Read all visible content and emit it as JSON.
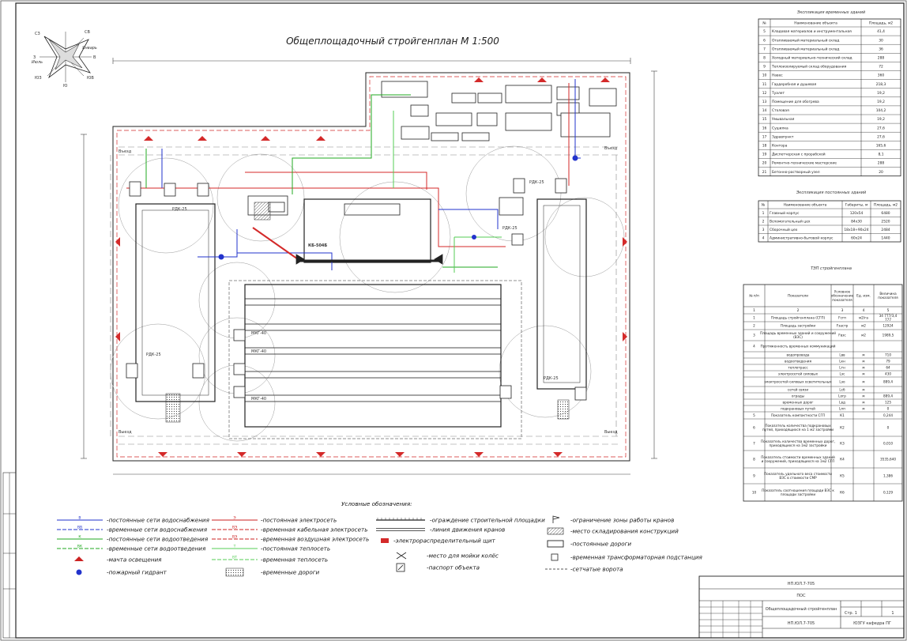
{
  "title": "Общеплощадочный стройгенплан М 1:500",
  "wind_rose": {
    "labels": [
      "СВ",
      "СЗ",
      "Январь",
      "З",
      "В",
      "Июль",
      "ЮЗ",
      "Ю",
      "ЮВ"
    ]
  },
  "plan_labels": {
    "entry_1": "Въезд",
    "entry_2": "Въезд",
    "exit_1": "Выезд",
    "exit_2": "Выезд",
    "crane_kb": "КБ-504Б",
    "rdk_1": "РДК-25",
    "rdk_2": "РДК-25",
    "rdk_3": "РДК-25",
    "rdk_4": "РДК-25",
    "rdk_5": "РДК-25",
    "mkg_1": "МКГ-40",
    "mkg_2": "МКГ-40",
    "mkg_3": "МКГ-40"
  },
  "temp_buildings": {
    "heading": "Экспликация временных зданий",
    "columns": [
      "№",
      "Наименование объекта",
      "Площадь, м2"
    ],
    "rows": [
      [
        "5",
        "Кладовая материалов и инструментальная",
        "41,4"
      ],
      [
        "6",
        "Отапливаемый материальный склад",
        "30"
      ],
      [
        "7",
        "Отапливаемый материальный склад",
        "36"
      ],
      [
        "8",
        "Холодный материально-технический склад",
        "288"
      ],
      [
        "9",
        "Теплоизолируемый склад оборудования",
        "72"
      ],
      [
        "10",
        "Навес",
        "360"
      ],
      [
        "11",
        "Гардеробная и душевая",
        "218,3"
      ],
      [
        "12",
        "Туалет",
        "19,2"
      ],
      [
        "13",
        "Помещение для обогрева",
        "19,2"
      ],
      [
        "14",
        "Столовая",
        "104,2"
      ],
      [
        "15",
        "Умывальная",
        "19,2"
      ],
      [
        "16",
        "Сушилка",
        "27,6"
      ],
      [
        "17",
        "Здравпункт",
        "27,6"
      ],
      [
        "18",
        "Контора",
        "165,6"
      ],
      [
        "19",
        "Диспетчерская с прорабской",
        "8,1"
      ],
      [
        "20",
        "Ремонтно-технические мастерские",
        "288"
      ],
      [
        "21",
        "Бетонно-растворный узел",
        "20"
      ]
    ]
  },
  "perm_buildings": {
    "heading": "Экспликация постоянных зданий",
    "columns": [
      "№",
      "Наименование объекта",
      "Габариты, м",
      "Площадь, м2"
    ],
    "rows": [
      [
        "1",
        "Главный корпус",
        "120х54",
        "6480"
      ],
      [
        "2",
        "Вспомогательный цех",
        "84х30",
        "2520"
      ],
      [
        "3",
        "Сборочный цех",
        "18х18+90х24",
        "2484"
      ],
      [
        "4",
        "Административно-бытовой корпус",
        "60х24",
        "1440"
      ]
    ]
  },
  "tep": {
    "heading": "ТЭП стройгенплана",
    "columns": [
      "№ п/п",
      "Показатели",
      "Условное обозначение показателя",
      "Ед. изм.",
      "Величина показателя"
    ],
    "numbers": [
      "1",
      "2",
      "3",
      "4",
      "5"
    ],
    "rows": [
      [
        "1",
        "Площадь стройгенплана (СГП)",
        "Fсгп",
        "м2/га",
        "34 777/3,4 777"
      ],
      [
        "2",
        "Площадь застройки",
        "Fзастр",
        "м2",
        "12924"
      ],
      [
        "3",
        "Площадь временных зданий и сооружений (ВЗС)",
        "Fвзс",
        "м2",
        "1989,5"
      ],
      [
        "4",
        "Протяженность временных коммуникаций",
        "",
        "",
        ""
      ],
      [
        "",
        "водопровода",
        "Lвв",
        "м",
        "710"
      ],
      [
        "",
        "водоотведения",
        "Lкн",
        "м",
        "79"
      ],
      [
        "",
        "теплотрасс",
        "Lтн",
        "м",
        "64"
      ],
      [
        "",
        "электросетей силовых",
        "Lэс",
        "м",
        "430"
      ],
      [
        "",
        "электросетей силовых осветительных",
        "Lэо",
        "м",
        "889,4"
      ],
      [
        "",
        "сетей связи",
        "Lсб",
        "м",
        ""
      ],
      [
        "",
        "ограды",
        "Lогр",
        "м",
        "889,4"
      ],
      [
        "",
        "временных дорог",
        "Lвд",
        "м",
        "125"
      ],
      [
        "",
        "подкрановых путей",
        "Lпп",
        "м",
        "0"
      ],
      [
        "5",
        "Показатель компактности СГП",
        "К1",
        "",
        "0,244"
      ],
      [
        "6",
        "Показатель количества подкрановых путей, приходящихся на 1 м2 застройки",
        "К2",
        "",
        "0"
      ],
      [
        "7",
        "Показатель количества временных дорог, приходящихся на 1м2 застройки",
        "К3",
        "",
        "0,010"
      ],
      [
        "8",
        "Показатель стоимости временных зданий и сооружений, приходящихся на 1м2 СГП",
        "К4",
        "",
        "3535,640"
      ],
      [
        "9",
        "Показатель удельного веса стоимости ВЗС в стоимости СМР",
        "К5",
        "",
        "1,386"
      ],
      [
        "10",
        "Показатель соотношения площади ВЗС к площади застройки",
        "К6",
        "",
        "0,129"
      ]
    ]
  },
  "legend": {
    "heading": "Условные обозначения:",
    "col1": [
      {
        "code": "В",
        "color": "#2233cc",
        "text": "-постоянные сети водоснабжения"
      },
      {
        "code": "ВВ",
        "color": "#2233cc",
        "text": "-временные сети водоснабжения"
      },
      {
        "code": "К",
        "color": "#22aa22",
        "text": "-постоянные сети водоотведения"
      },
      {
        "code": "ВК",
        "color": "#22aa22",
        "text": "-временные сети водоотведения"
      },
      {
        "code": "",
        "color": "#cc2222",
        "text": "-мачта освещения"
      },
      {
        "code": "",
        "color": "#2233cc",
        "text": "-пожарный гидрант"
      }
    ],
    "col2": [
      {
        "code": "Э",
        "color": "#cc2222",
        "text": "-постоянная электросеть"
      },
      {
        "code": "ВЭ",
        "color": "#cc2222",
        "text": "-временная кабельная электросеть"
      },
      {
        "code": "ВЭ",
        "color": "#cc2222",
        "text": "-временная воздушная электросеть"
      },
      {
        "code": "Т",
        "color": "#55cc55",
        "text": "-постоянная теплосеть"
      },
      {
        "code": "ВТ",
        "color": "#55cc55",
        "text": "-временная теплосеть"
      },
      {
        "code": "",
        "color": "#333333",
        "text": "-временные дороги"
      }
    ],
    "col3": [
      {
        "text": "-ограждение строительной площадки"
      },
      {
        "text": "-линия движения кранов"
      },
      {
        "text": "-электрораспределительный щит"
      },
      {
        "text": "-место для мойки колёс"
      },
      {
        "text": "-паспорт объекта"
      }
    ],
    "col4": [
      {
        "text": "-ограничение зоны работы кранов"
      },
      {
        "text": "-место складирования конструкций"
      },
      {
        "text": "-постоянные дороги"
      },
      {
        "text": "-временная трансформаторная подстанция"
      },
      {
        "text": "-сетчатые ворота"
      }
    ]
  },
  "title_block": {
    "code": "НП.ЮЛ.7-705",
    "stage": "ПОС",
    "drawing_name": "Общеплощадочный стройгенплан",
    "sheet": "Стр. 1",
    "sheets": "1",
    "org": "ЮЗГУ кафедра ПГ"
  },
  "colors": {
    "red": "#d42a2a",
    "blue": "#2233cc",
    "green": "#22aa22",
    "lightgreen": "#55cc55"
  }
}
